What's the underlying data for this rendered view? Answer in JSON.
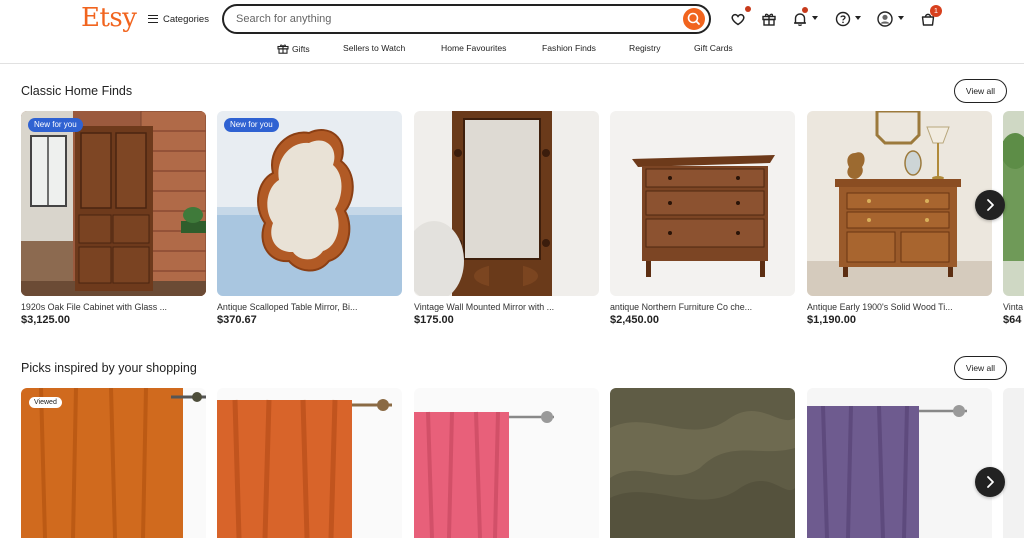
{
  "header": {
    "logo": "Etsy",
    "categories_label": "Categories",
    "search_placeholder": "Search for anything",
    "cart_count": "1"
  },
  "nav": {
    "items": [
      "Gifts",
      "Sellers to Watch",
      "Home Favourites",
      "Fashion Finds",
      "Registry",
      "Gift Cards"
    ]
  },
  "sections": [
    {
      "title": "Classic Home Finds",
      "view_all": "View all",
      "cards": [
        {
          "title": "1920s Oak File Cabinet with Glass ...",
          "price": "$3,125.00",
          "badge": "New for you"
        },
        {
          "title": "Antique Scalloped Table Mirror, Bi...",
          "price": "$370.67",
          "badge": "New for you"
        },
        {
          "title": "Vintage Wall Mounted Mirror with ...",
          "price": "$175.00"
        },
        {
          "title": "antique Northern Furniture Co che...",
          "price": "$2,450.00"
        },
        {
          "title": "Antique Early 1900's Solid Wood Ti...",
          "price": "$1,190.00"
        },
        {
          "title": "Vinta",
          "price": "$64"
        }
      ]
    },
    {
      "title": "Picks inspired by your shopping",
      "view_all": "View all",
      "cards": [
        {
          "badge": "Viewed"
        },
        {},
        {},
        {},
        {},
        {}
      ]
    }
  ]
}
